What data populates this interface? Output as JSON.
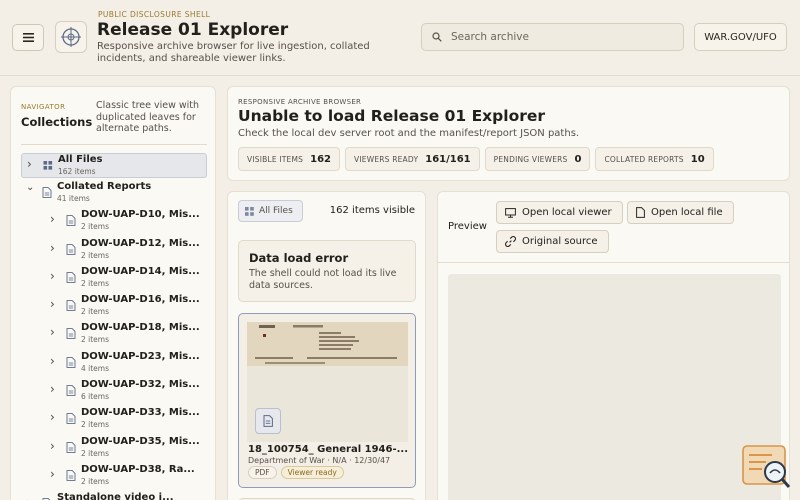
{
  "header": {
    "eyebrow": "PUBLIC DISCLOSURE SHELL",
    "title": "Release 01 Explorer",
    "subtitle": "Responsive archive browser for live ingestion, collated incidents, and shareable viewer links.",
    "search_placeholder": "Search archive",
    "site_button": "WAR.GOV/UFO"
  },
  "navigator": {
    "eyebrow": "NAVIGATOR",
    "title": "Collections",
    "description": "Classic tree view with duplicated leaves for alternate paths.",
    "tree": [
      {
        "label": "All Files",
        "count": "162 items",
        "level": 0,
        "selected": true
      },
      {
        "label": "Collated Reports",
        "count": "41 items",
        "level": 0,
        "expanded": true
      },
      {
        "label": "DOW-UAP-D10, Mis...",
        "count": "2 items",
        "level": 1
      },
      {
        "label": "DOW-UAP-D12, Mis...",
        "count": "2 items",
        "level": 1
      },
      {
        "label": "DOW-UAP-D14, Mis...",
        "count": "2 items",
        "level": 1
      },
      {
        "label": "DOW-UAP-D16, Mis...",
        "count": "2 items",
        "level": 1
      },
      {
        "label": "DOW-UAP-D18, Mis...",
        "count": "2 items",
        "level": 1
      },
      {
        "label": "DOW-UAP-D23, Mis...",
        "count": "4 items",
        "level": 1
      },
      {
        "label": "DOW-UAP-D32, Mis...",
        "count": "6 items",
        "level": 1
      },
      {
        "label": "DOW-UAP-D33, Mis...",
        "count": "2 items",
        "level": 1
      },
      {
        "label": "DOW-UAP-D35, Mis...",
        "count": "2 items",
        "level": 1
      },
      {
        "label": "DOW-UAP-D38, Ra...",
        "count": "2 items",
        "level": 1
      },
      {
        "label": "Standalone video i...",
        "count": "",
        "level": 0
      }
    ]
  },
  "status": {
    "eyebrow": "RESPONSIVE ARCHIVE BROWSER",
    "title": "Unable to load Release 01 Explorer",
    "subtitle": "Check the local dev server root and the manifest/report JSON paths.",
    "stats": [
      {
        "label": "VISIBLE ITEMS",
        "value": "162"
      },
      {
        "label": "VIEWERS READY",
        "value": "161/161"
      },
      {
        "label": "PENDING VIEWERS",
        "value": "0"
      },
      {
        "label": "COLLATED REPORTS",
        "value": "10"
      }
    ]
  },
  "list": {
    "filter_label": "All Files",
    "visible_count": "162 items visible",
    "error_title": "Data load error",
    "error_text": "The shell could not load its live data sources.",
    "card": {
      "title": "18_100754_ General 1946-...",
      "meta": "Department of War · N/A · 12/30/47",
      "tag_type": "PDF",
      "tag_status": "Viewer ready"
    }
  },
  "preview": {
    "label": "Preview",
    "open_viewer": "Open local viewer",
    "open_file": "Open local file",
    "original_source": "Original source"
  },
  "colors": {
    "accent_gold": "#9a7a2c",
    "background": "#f3efe6",
    "selected_border": "#8f9cb7"
  }
}
